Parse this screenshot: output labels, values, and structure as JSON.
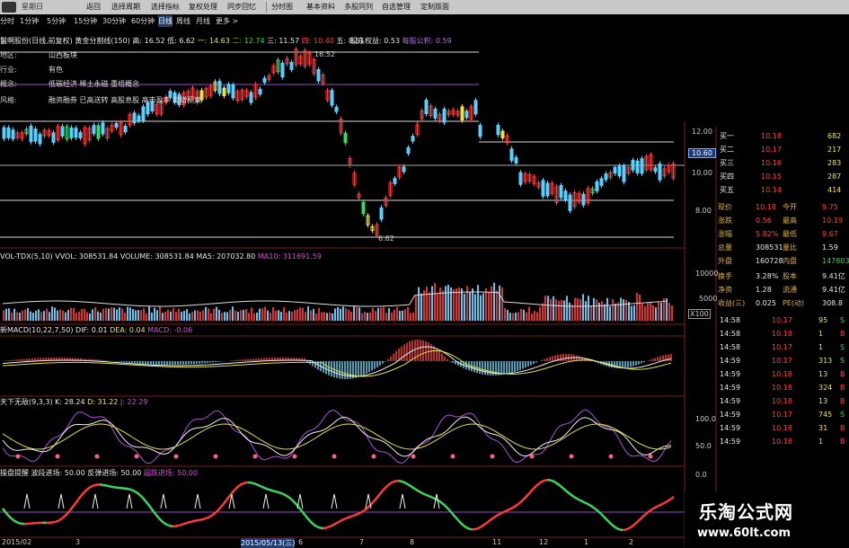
{
  "toolbar": {
    "items": [
      "返回",
      "选择周期",
      "选择指标",
      "复权处理",
      "同步回忆",
      "分时图",
      "基本资料",
      "多股同列",
      "自选管理",
      "定制版面"
    ],
    "logo_text": "星期日"
  },
  "periods": {
    "items": [
      "分时",
      "1分钟",
      "5分钟",
      "15分钟",
      "30分钟",
      "60分钟",
      "日线",
      "周线",
      "月线",
      "更多 >"
    ],
    "active": "日线"
  },
  "main_info": {
    "name": "鬣啊股份(日线,前复权)",
    "indicator": "黄金分割线(150)",
    "high": "高: 16.52",
    "low": "低: 6.62",
    "one": "一: 14.63",
    "two": "二: 12.74",
    "three": "三: 11.57",
    "four": "四: 10.40",
    "five": "五: 8.51",
    "extra1": "股东权益: 0.53",
    "extra2": "每股公积: 0.59"
  },
  "stock_info": {
    "labels": [
      "地区:",
      "行业:",
      "概念:",
      "风格:"
    ],
    "values": [
      "山西板块",
      "有色",
      "低碳经济 稀土永磁 重组概念",
      "融资融券 已高送转 高股息股 高市盈率 定增预案"
    ]
  },
  "price_marks": {
    "high": "16.52",
    "low": "6.62",
    "current": "10.60"
  },
  "price_axis": [
    "12.00",
    "10.00",
    "8.00"
  ],
  "volume_info": {
    "name": "VOL-TDX(5,10)",
    "vvol": "VVOL: 308531.84",
    "volume": "VOLUME: 308531.84",
    "ma5": "MA5: 207032.80",
    "ma10": "MA10: 311691.59"
  },
  "volume_axis": [
    "10000",
    "5000",
    "X100"
  ],
  "macd_info": {
    "name": "新MACD(10,22,7,50)",
    "dif": "DIF: 0.01",
    "dea": "DEA: 0.04",
    "macd": "MACD: -0.06"
  },
  "kdj_info": {
    "name": "天下无敌(9,3,3)",
    "k": "K: 28.24",
    "d": "D: 31.22",
    "j": "J: 22.29"
  },
  "kdj_axis": [
    "100.0",
    "50.0",
    "0.0"
  ],
  "bottom_info": {
    "name": "操盘提醒",
    "a": "波段进场: 50.00",
    "b": "反弹进场: 50.00",
    "c": "超跌进场: 50.00"
  },
  "date_axis": [
    "2015/02",
    "3",
    "2015/05/13(三)",
    "6",
    "7",
    "8",
    "11",
    "12",
    "1",
    "2"
  ],
  "quotes": {
    "asks": [
      {
        "label": "买一",
        "price": "10.18",
        "vol": "682"
      },
      {
        "label": "买二",
        "price": "10.17",
        "vol": "217"
      },
      {
        "label": "买三",
        "price": "10.16",
        "vol": "283"
      },
      {
        "label": "买四",
        "price": "10.15",
        "vol": "287"
      },
      {
        "label": "买五",
        "price": "10.14",
        "vol": "414"
      }
    ],
    "stats": [
      {
        "l1": "现价",
        "v1": "10.18",
        "l2": "今开",
        "v2": "9.75"
      },
      {
        "l1": "涨跌",
        "v1": "0.56",
        "l2": "最高",
        "v2": "10.19"
      },
      {
        "l1": "涨幅",
        "v1": "5.82%",
        "l2": "最低",
        "v2": "9.67"
      },
      {
        "l1": "总量",
        "v1": "308531",
        "l2": "量比",
        "v2": "1.59"
      },
      {
        "l1": "外盘",
        "v1": "160728",
        "l2": "内盘",
        "v2": "147803"
      },
      {
        "l1": "换手",
        "v1": "3.28%",
        "l2": "股本",
        "v2": "9.41亿"
      },
      {
        "l1": "净资",
        "v1": "1.28",
        "l2": "流通",
        "v2": "9.41亿"
      },
      {
        "l1": "收益(三)",
        "v1": "0.025",
        "l2": "PE(动)",
        "v2": "308.8"
      }
    ],
    "ticks": [
      {
        "t": "14:58",
        "p": "10.17",
        "v": "95",
        "s": "S"
      },
      {
        "t": "14:58",
        "p": "10.18",
        "v": "1",
        "s": "B"
      },
      {
        "t": "14:58",
        "p": "10.17",
        "v": "1",
        "s": "S"
      },
      {
        "t": "14:59",
        "p": "10.17",
        "v": "313",
        "s": "S"
      },
      {
        "t": "14:59",
        "p": "10.18",
        "v": "13",
        "s": "B"
      },
      {
        "t": "14:59",
        "p": "10.18",
        "v": "324",
        "s": "B"
      },
      {
        "t": "14:59",
        "p": "10.18",
        "v": "13",
        "s": "B"
      },
      {
        "t": "14:59",
        "p": "10.17",
        "v": "745",
        "s": "S"
      },
      {
        "t": "14:59",
        "p": "10.18",
        "v": "31",
        "s": "B"
      },
      {
        "t": "14:59",
        "p": "10.18",
        "v": "1",
        "s": "B"
      }
    ]
  },
  "watermark": {
    "title": "乐淘公式网",
    "url": "www.60lt.com"
  }
}
